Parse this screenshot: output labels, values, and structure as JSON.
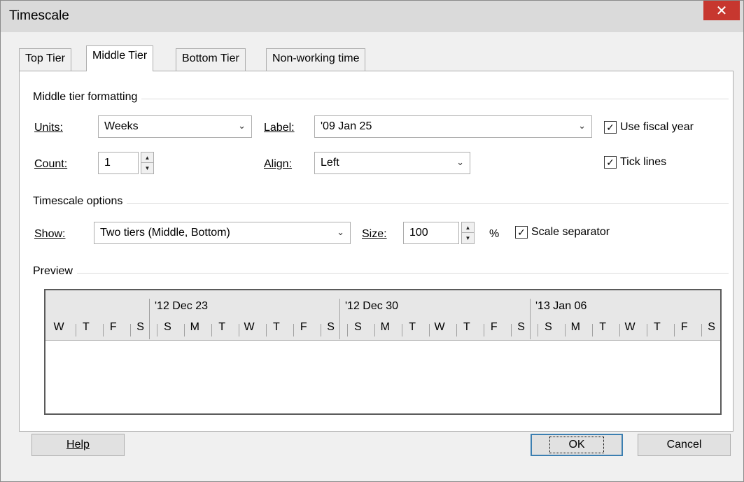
{
  "window": {
    "title": "Timescale",
    "close_glyph": "✕"
  },
  "tabs": [
    {
      "label": "Top Tier",
      "active": false
    },
    {
      "label": "Middle Tier",
      "active": true
    },
    {
      "label": "Bottom Tier",
      "active": false
    },
    {
      "label": "Non-working time",
      "active": false
    }
  ],
  "middle_tier": {
    "group_label": "Middle tier formatting",
    "units_label": "Units:",
    "units_value": "Weeks",
    "label_label": "Label:",
    "label_value": "'09 Jan 25",
    "use_fiscal_year_label": "Use fiscal year",
    "use_fiscal_year_checked": true,
    "count_label": "Count:",
    "count_value": "1",
    "align_label": "Align:",
    "align_value": "Left",
    "tick_lines_label": "Tick lines",
    "tick_lines_checked": true
  },
  "timescale_options": {
    "group_label": "Timescale options",
    "show_label": "Show:",
    "show_value": "Two tiers (Middle, Bottom)",
    "size_label": "Size:",
    "size_value": "100",
    "size_unit": "%",
    "scale_separator_label": "Scale separator",
    "scale_separator_checked": true
  },
  "preview": {
    "group_label": "Preview",
    "weeks": [
      "'12 Dec 23",
      "'12 Dec 30",
      "'13 Jan 06"
    ],
    "days": [
      "W",
      "T",
      "F",
      "S",
      "S",
      "M",
      "T",
      "W",
      "T",
      "F",
      "S",
      "S",
      "M",
      "T",
      "W",
      "T",
      "F",
      "S",
      "S",
      "M",
      "T",
      "W",
      "T",
      "F",
      "S"
    ]
  },
  "buttons": {
    "help": "Help",
    "ok": "OK",
    "cancel": "Cancel"
  },
  "icons": {
    "dropdown": "chevron-down-icon",
    "spin_up": "spin-up-icon",
    "spin_down": "spin-down-icon",
    "check": "check-icon",
    "close": "close-icon"
  }
}
